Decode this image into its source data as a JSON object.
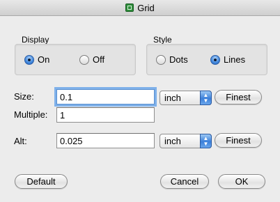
{
  "window": {
    "title": "Grid",
    "icon": "grid-app-icon"
  },
  "display": {
    "label": "Display",
    "options": [
      {
        "label": "On",
        "selected": true
      },
      {
        "label": "Off",
        "selected": false
      }
    ]
  },
  "style": {
    "label": "Style",
    "options": [
      {
        "label": "Dots",
        "selected": false
      },
      {
        "label": "Lines",
        "selected": true
      }
    ]
  },
  "size": {
    "label": "Size:",
    "value": "0.1",
    "unit": "inch",
    "button": "Finest"
  },
  "multiple": {
    "label": "Multiple:",
    "value": "1"
  },
  "alt": {
    "label": "Alt:",
    "value": "0.025",
    "unit": "inch",
    "button": "Finest"
  },
  "buttons": {
    "default": "Default",
    "cancel": "Cancel",
    "ok": "OK"
  },
  "colors": {
    "accent": "#3f86dc",
    "focus_ring": "#7fb1ea",
    "background": "#ececec"
  }
}
